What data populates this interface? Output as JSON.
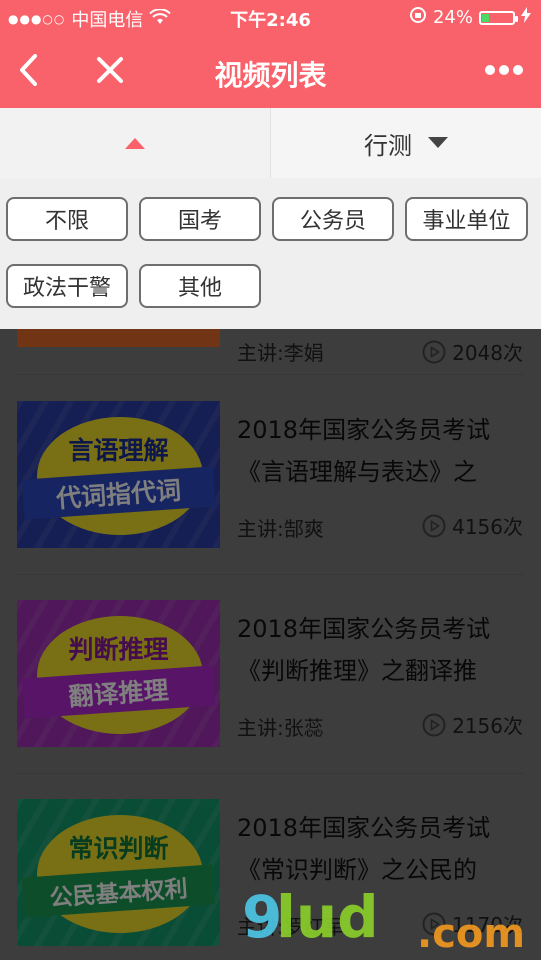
{
  "status_bar": {
    "carrier": "中国电信",
    "time": "下午2:46",
    "battery": "24%",
    "battery_level": 0.24
  },
  "nav": {
    "title": "视频列表"
  },
  "filters": {
    "tab1_label": "",
    "tab2_label": "行测",
    "options": [
      "不限",
      "国考",
      "公务员",
      "事业单位",
      "政法干警",
      "其他"
    ]
  },
  "list": {
    "partial_item": {
      "teacher": "主讲:李娟",
      "plays": "2048次"
    },
    "items": [
      {
        "title_line1": "2018年国家公务员考试",
        "title_line2": "《言语理解与表达》之",
        "teacher": "主讲:郜爽",
        "plays": "4156次",
        "thumb_line1": "言语理解",
        "thumb_line2": "代词指代词"
      },
      {
        "title_line1": "2018年国家公务员考试",
        "title_line2": "《判断推理》之翻译推",
        "teacher": "主讲:张蕊",
        "plays": "2156次",
        "thumb_line1": "判断推理",
        "thumb_line2": "翻译推理"
      },
      {
        "title_line1": "2018年国家公务员考试",
        "title_line2": "《常识判断》之公民的",
        "teacher": "主讲:罗红军",
        "plays": "1170次",
        "thumb_line1": "常识判断",
        "thumb_line2": "公民基本权利"
      }
    ]
  },
  "colors": {
    "brand": "#f9626a",
    "thumb1_bg": "#2b3ea8",
    "thumb2_bg": "#a12fb5",
    "thumb3_bg": "#159b6e",
    "thumb_oval": "#f2e12a",
    "ribbon1": "#2c49c2",
    "ribbon2": "#b02ad0",
    "ribbon3": "#1a9a52"
  },
  "watermark": "9lud.com"
}
